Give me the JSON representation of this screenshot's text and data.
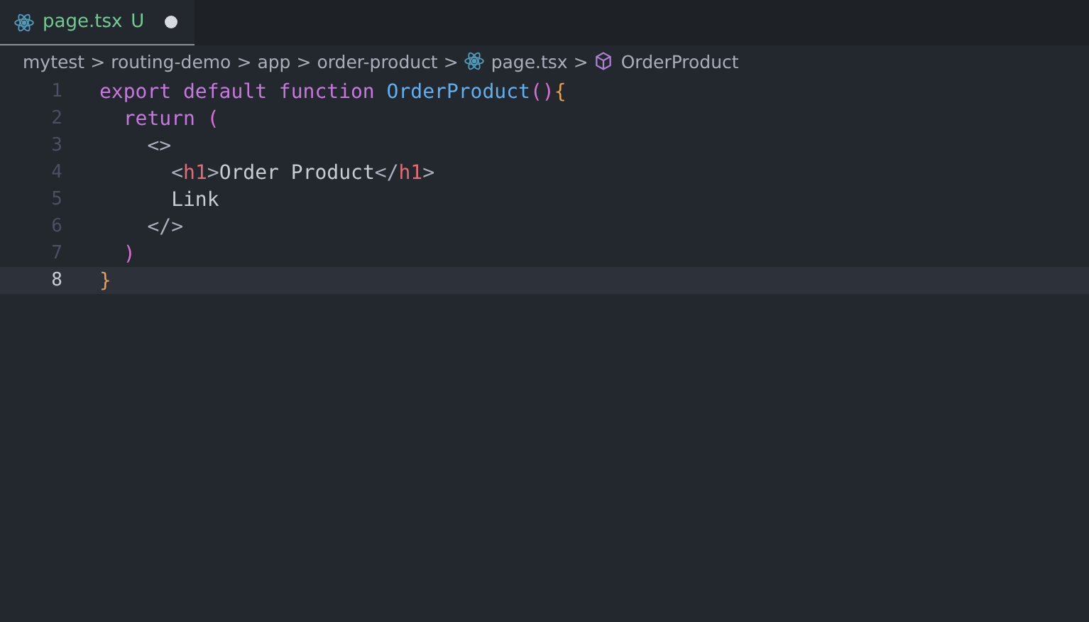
{
  "tabs": [
    {
      "label": "page.tsx",
      "status": "U",
      "modified": true,
      "selected": true
    }
  ],
  "breadcrumbs": [
    {
      "label": "mytest",
      "kind": "folder"
    },
    {
      "label": "routing-demo",
      "kind": "folder"
    },
    {
      "label": "app",
      "kind": "folder"
    },
    {
      "label": "order-product",
      "kind": "folder"
    },
    {
      "label": "page.tsx",
      "kind": "react"
    },
    {
      "label": "OrderProduct",
      "kind": "symbol"
    }
  ],
  "separator": ">",
  "lines": [
    {
      "number": "1",
      "current": false,
      "tokens": [
        {
          "text": "export default function ",
          "kind": "keyword"
        },
        {
          "text": "OrderProduct",
          "kind": "function"
        },
        {
          "text": "()",
          "kind": "paren"
        },
        {
          "text": "{",
          "kind": "brace"
        }
      ]
    },
    {
      "number": "2",
      "current": false,
      "tokens": [
        {
          "text": "  return ",
          "kind": "keyword"
        },
        {
          "text": "(",
          "kind": "paren"
        }
      ]
    },
    {
      "number": "3",
      "current": false,
      "tokens": [
        {
          "text": "    <>",
          "kind": "punct"
        }
      ]
    },
    {
      "number": "4",
      "current": false,
      "tokens": [
        {
          "text": "      <",
          "kind": "punct"
        },
        {
          "text": "h1",
          "kind": "tag"
        },
        {
          "text": ">",
          "kind": "punct"
        },
        {
          "text": "Order Product",
          "kind": "plain"
        },
        {
          "text": "</",
          "kind": "punct"
        },
        {
          "text": "h1",
          "kind": "tag"
        },
        {
          "text": ">",
          "kind": "punct"
        }
      ]
    },
    {
      "number": "5",
      "current": false,
      "tokens": [
        {
          "text": "      Link",
          "kind": "plain"
        }
      ]
    },
    {
      "number": "6",
      "current": false,
      "tokens": [
        {
          "text": "    </>",
          "kind": "punct"
        }
      ]
    },
    {
      "number": "7",
      "current": false,
      "tokens": [
        {
          "text": "  )",
          "kind": "paren"
        }
      ]
    },
    {
      "number": "8",
      "current": true,
      "tokens": [
        {
          "text": "}",
          "kind": "brace"
        }
      ]
    }
  ]
}
